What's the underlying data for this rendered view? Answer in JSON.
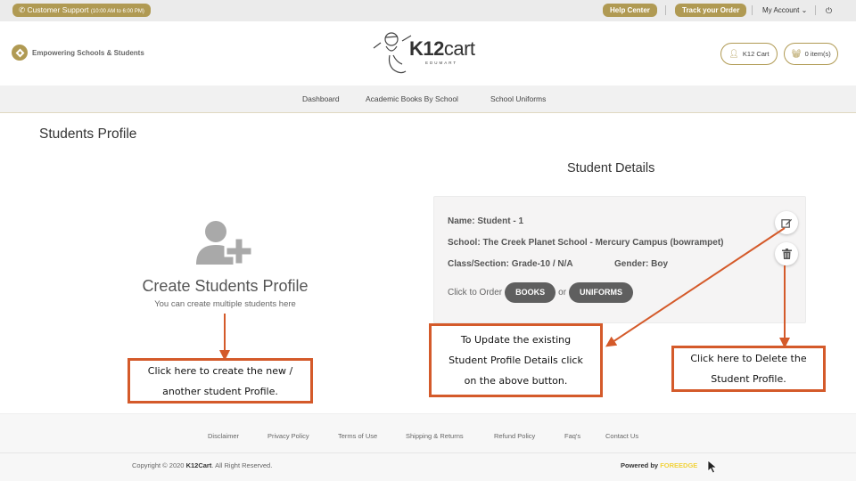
{
  "topbar": {
    "support_label": "Customer Support",
    "support_hours": "(10:00 AM to 6:00 PM)",
    "help_center": "Help Center",
    "track_order": "Track your Order",
    "my_account": "My Account"
  },
  "header": {
    "tagline": "Empowering Schools & Students",
    "logo_bold": "K12",
    "logo_light": "cart",
    "logo_sub": "EDUMART",
    "account_button": "K12 Cart",
    "cart_button": "0 item(s)"
  },
  "nav": {
    "items": [
      {
        "label": "Dashboard"
      },
      {
        "label": "Academic Books By School"
      },
      {
        "label": "School Uniforms"
      }
    ]
  },
  "main": {
    "page_title": "Students Profile",
    "create": {
      "title": "Create Students Profile",
      "subtitle": "You can create multiple students here"
    },
    "details": {
      "title": "Student Details",
      "name": "Name: Student - 1",
      "school": "School: The Creek Planet School - Mercury Campus (bowrampet)",
      "class_section": "Class/Section: Grade-10 / N/A",
      "gender": "Gender: Boy",
      "order_prefix": "Click to Order",
      "books_button": "BOOKS",
      "or_text": "or",
      "uniforms_button": "UNIFORMS"
    }
  },
  "annotations": {
    "create_note_line1": "Click here to create the new /",
    "create_note_line2": "another student Profile.",
    "update_note_line1": "To Update the existing",
    "update_note_line2": "Student Profile Details click",
    "update_note_line3": "on the above button.",
    "delete_note_line1": "Click here to Delete the",
    "delete_note_line2": "Student Profile."
  },
  "footer": {
    "links": [
      {
        "label": "Disclaimer"
      },
      {
        "label": "Privacy Policy"
      },
      {
        "label": "Terms of Use"
      },
      {
        "label": "Shipping & Returns"
      },
      {
        "label": "Refund Policy"
      },
      {
        "label": "Faq's"
      },
      {
        "label": "Contact Us"
      }
    ],
    "copyright_prefix": "Copyright © 2020",
    "copyright_brand": "K12Cart",
    "copyright_suffix": ". All Right Reserved.",
    "powered_prefix": "Powered by",
    "powered_brand": "FOREEDGE"
  },
  "colors": {
    "brand_gold": "#b09a53",
    "annotation_orange": "#d45a2a",
    "dark_button": "#5f5f5f",
    "powered_yellow": "#f2d23a"
  }
}
